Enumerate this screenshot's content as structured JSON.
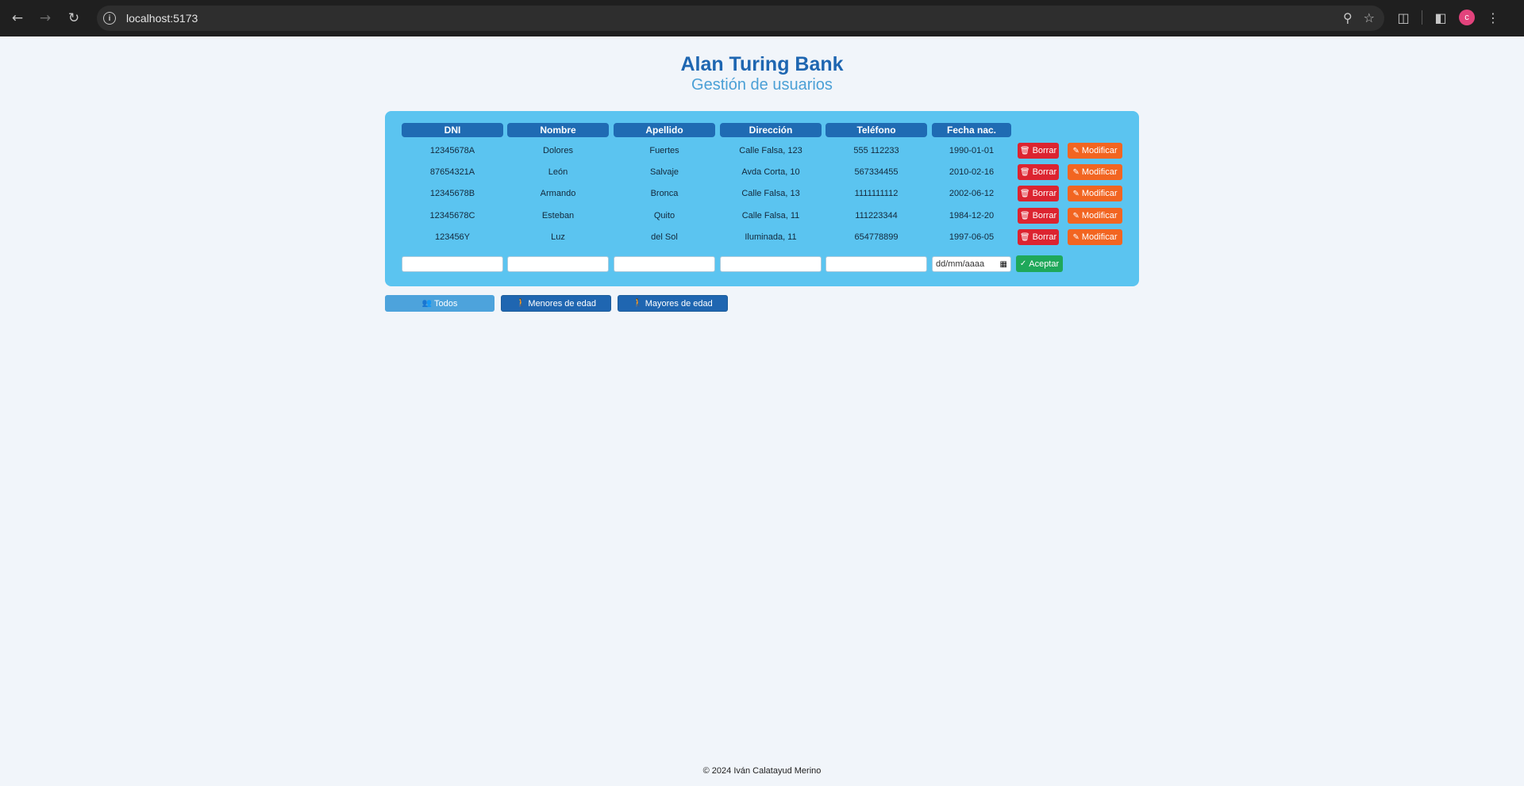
{
  "browser": {
    "url": "localhost:5173",
    "profile_initial": "c"
  },
  "header": {
    "title": "Alan Turing Bank",
    "subtitle": "Gestión de usuarios"
  },
  "table": {
    "headers": [
      "DNI",
      "Nombre",
      "Apellido",
      "Dirección",
      "Teléfono",
      "Fecha nac."
    ],
    "rows": [
      {
        "dni": "12345678A",
        "nombre": "Dolores",
        "apellido": "Fuertes",
        "direccion": "Calle Falsa, 123",
        "telefono": "555 112233",
        "fecha": "1990-01-01"
      },
      {
        "dni": "87654321A",
        "nombre": "León",
        "apellido": "Salvaje",
        "direccion": "Avda Corta, 10",
        "telefono": "567334455",
        "fecha": "2010-02-16"
      },
      {
        "dni": "12345678B",
        "nombre": "Armando",
        "apellido": "Bronca",
        "direccion": "Calle Falsa, 13",
        "telefono": "1111111112",
        "fecha": "2002-06-12"
      },
      {
        "dni": "12345678C",
        "nombre": "Esteban",
        "apellido": "Quito",
        "direccion": "Calle Falsa, 11",
        "telefono": "111223344",
        "fecha": "1984-12-20"
      },
      {
        "dni": "123456Y",
        "nombre": "Luz",
        "apellido": "del Sol",
        "direccion": "Iluminada, 11",
        "telefono": "654778899",
        "fecha": "1997-06-05"
      }
    ],
    "delete_label": "Borrar",
    "modify_label": "Modificar"
  },
  "form": {
    "date_placeholder": "dd/mm/aaaa",
    "accept_label": "Aceptar"
  },
  "filters": {
    "all": "Todos",
    "minors": "Menores de edad",
    "adults": "Mayores de edad",
    "active": "all"
  },
  "footer": {
    "text": "© 2024 Iván Calatayud Merino"
  },
  "colors": {
    "title": "#1e66b1",
    "subtitle": "#4ba0d6",
    "panel": "#5bc4f0",
    "header_cell": "#1f6bb3",
    "delete": "#dc2430",
    "modify": "#f26521",
    "accept": "#1fa85a",
    "filter_active": "#4da3dc",
    "filter_inactive": "#1f66b1"
  }
}
